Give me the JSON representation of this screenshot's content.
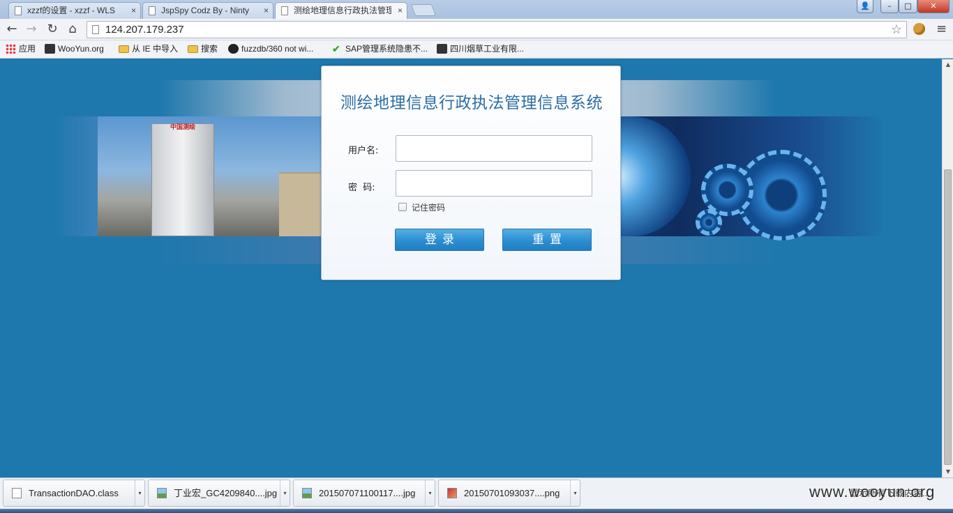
{
  "tabs": [
    {
      "title": "xzzf的设置 - xzzf - WLS",
      "close": "×"
    },
    {
      "title": "JspSpy Codz By - Ninty",
      "close": "×"
    },
    {
      "title": "测绘地理信息行政执法管理",
      "close": "×"
    }
  ],
  "window_controls": {
    "minimize": "–",
    "maximize": "□",
    "close": "✕",
    "user": "👤"
  },
  "toolbar": {
    "back": "←",
    "forward": "→",
    "reload": "↻",
    "home": "⌂",
    "url": "124.207.179.237",
    "star": "☆",
    "menu": "≡"
  },
  "bookmarks": [
    {
      "label": "应用"
    },
    {
      "label": "WooYun.org"
    },
    {
      "label": "从 IE 中导入"
    },
    {
      "label": "搜索"
    },
    {
      "label": "fuzzdb/360 not wi..."
    },
    {
      "label": "SAP管理系统隐患不..."
    },
    {
      "label": "四川烟草工业有限..."
    }
  ],
  "banner": {
    "tower_sign": "中国测绘"
  },
  "login": {
    "title": "测绘地理信息行政执法管理信息系统",
    "username_label": "用户名:",
    "password_label": "密  码:",
    "username_value": "",
    "password_value": "",
    "remember_label": "记住密码",
    "login_button": "登录",
    "reset_button": "重置"
  },
  "scrollbar": {
    "up": "▲",
    "down": "▼"
  },
  "downloads": [
    {
      "name": "TransactionDAO.class",
      "type": "class"
    },
    {
      "name": "丁业宏_GC4209840....jpg",
      "type": "img"
    },
    {
      "name": "201507071100117....jpg",
      "type": "img"
    },
    {
      "name": "20150701093037....png",
      "type": "png"
    }
  ],
  "downloads_menu": "▾",
  "show_all_downloads": "显示所有下载内容...",
  "watermark": "www.wooyun.org",
  "colors": {
    "page_background": "#1f78ad",
    "title_color": "#2a6ea5",
    "button_blue": "#2b8ed0"
  }
}
